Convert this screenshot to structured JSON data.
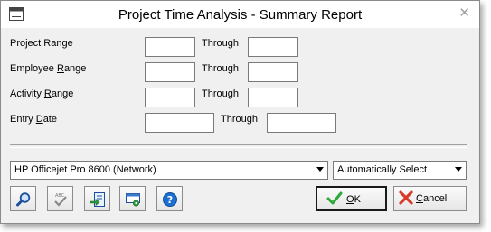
{
  "window": {
    "title": "Project Time Analysis - Summary Report",
    "close_glyph": "✕"
  },
  "form": {
    "project_range": {
      "label_pre": "Project Range",
      "label_ul": "",
      "label_post": "",
      "from": "",
      "to": ""
    },
    "employee_range": {
      "label_pre": "Employee ",
      "label_ul": "R",
      "label_post": "ange",
      "from": "",
      "to": ""
    },
    "activity_range": {
      "label_pre": "Activity ",
      "label_ul": "R",
      "label_post": "ange",
      "from": "",
      "to": ""
    },
    "entry_date": {
      "label_pre": "Entry ",
      "label_ul": "D",
      "label_post": "ate",
      "from": "",
      "to": ""
    },
    "through_label": "Through"
  },
  "printer": {
    "selected": "HP Officejet Pro 8600 (Network)",
    "tray": "Automatically Select"
  },
  "toolbar": {
    "icons": [
      "search-icon",
      "spellcheck-icon",
      "export-icon",
      "print-setup-icon",
      "help-icon"
    ]
  },
  "buttons": {
    "ok_ul": "O",
    "ok_rest": "K",
    "cancel_ul": "C",
    "cancel_rest": "ancel"
  },
  "colors": {
    "ok_check": "#2fa83a",
    "cancel_x": "#d83a2a",
    "help_blue": "#1c6fd1"
  }
}
